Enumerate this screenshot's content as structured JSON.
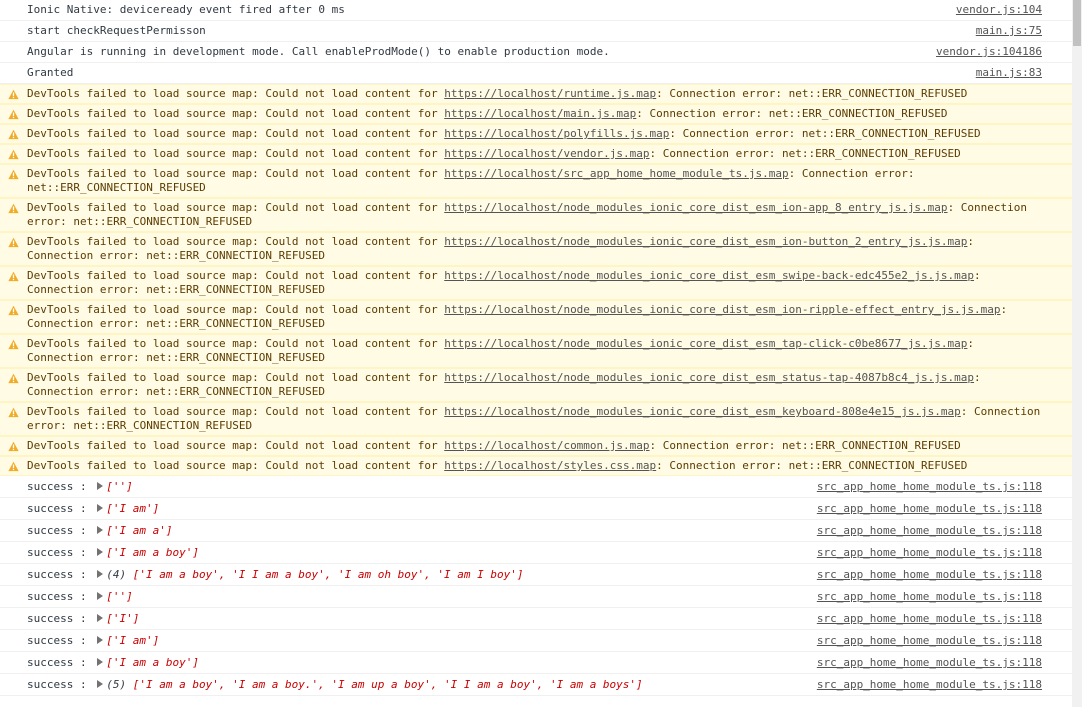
{
  "log_messages": [
    {
      "text": "Ionic Native: deviceready event fired after 0 ms",
      "source": "vendor.js:104"
    },
    {
      "text": "start checkRequestPermisson",
      "source": "main.js:75"
    },
    {
      "text": "Angular is running in development mode. Call enableProdMode() to enable production mode.",
      "source": "vendor.js:104186"
    },
    {
      "text": "Granted",
      "source": "main.js:83"
    }
  ],
  "warning": {
    "prefix": "DevTools failed to load source map: Could not load content for ",
    "suffix": ": Connection error: net::ERR_CONNECTION_REFUSED",
    "icon": "warning-triangle-icon",
    "color": "#f2ab26"
  },
  "warnings": [
    {
      "url": "https://localhost/runtime.js.map"
    },
    {
      "url": "https://localhost/main.js.map"
    },
    {
      "url": "https://localhost/polyfills.js.map"
    },
    {
      "url": "https://localhost/vendor.js.map"
    },
    {
      "url": "https://localhost/src_app_home_home_module_ts.js.map"
    },
    {
      "url": "https://localhost/node_modules_ionic_core_dist_esm_ion-app_8_entry_js.js.map"
    },
    {
      "url": "https://localhost/node_modules_ionic_core_dist_esm_ion-button_2_entry_js.js.map"
    },
    {
      "url": "https://localhost/node_modules_ionic_core_dist_esm_swipe-back-edc455e2_js.js.map"
    },
    {
      "url": "https://localhost/node_modules_ionic_core_dist_esm_ion-ripple-effect_entry_js.js.map"
    },
    {
      "url": "https://localhost/node_modules_ionic_core_dist_esm_tap-click-c0be8677_js.js.map"
    },
    {
      "url": "https://localhost/node_modules_ionic_core_dist_esm_status-tap-4087b8c4_js.js.map"
    },
    {
      "url": "https://localhost/node_modules_ionic_core_dist_esm_keyboard-808e4e15_js.js.map"
    },
    {
      "url": "https://localhost/common.js.map"
    },
    {
      "url": "https://localhost/styles.css.map"
    }
  ],
  "success_label": "success :",
  "success_source": "src_app_home_home_module_ts.js:118",
  "success_rows": [
    {
      "count": "",
      "value": "['']"
    },
    {
      "count": "",
      "value": "['I am']"
    },
    {
      "count": "",
      "value": "['I am a']"
    },
    {
      "count": "",
      "value": "['I am a boy']"
    },
    {
      "count": "(4)",
      "value": "['I am a boy', 'I I am a boy', 'I am oh boy', 'I am I boy']"
    },
    {
      "count": "",
      "value": "['']"
    },
    {
      "count": "",
      "value": "['I']"
    },
    {
      "count": "",
      "value": "['I am']"
    },
    {
      "count": "",
      "value": "['I am a boy']"
    },
    {
      "count": "(5)",
      "value": "['I am a boy', 'I am a boy.', 'I am up a boy', 'I I am a boy', 'I am a boys']"
    }
  ]
}
